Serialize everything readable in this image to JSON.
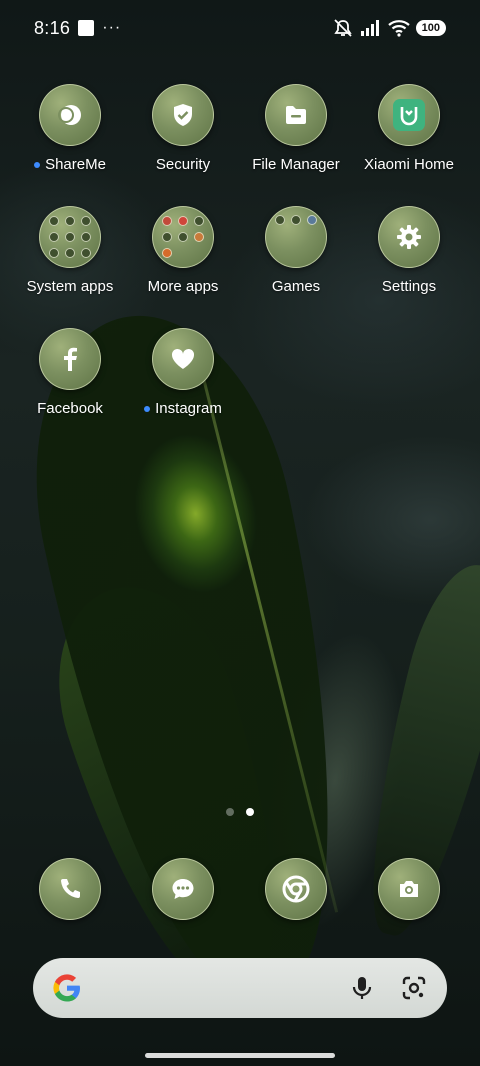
{
  "status_bar": {
    "time": "8:16",
    "overflow": "···",
    "battery": "100",
    "icons": [
      "mute-icon",
      "signal-icon",
      "wifi-icon"
    ]
  },
  "apps": [
    {
      "label": "ShareMe",
      "icon": "shareme-icon",
      "has_dot": true
    },
    {
      "label": "Security",
      "icon": "shield-icon",
      "has_dot": false
    },
    {
      "label": "File Manager",
      "icon": "folder-icon",
      "has_dot": false
    },
    {
      "label": "Xiaomi Home",
      "icon": "mi-home-icon",
      "has_dot": false
    },
    {
      "label": "System apps",
      "icon": "folder-system-apps",
      "has_dot": false
    },
    {
      "label": "More apps",
      "icon": "folder-more-apps",
      "has_dot": false
    },
    {
      "label": "Games",
      "icon": "folder-games",
      "has_dot": false
    },
    {
      "label": "Settings",
      "icon": "gear-icon",
      "has_dot": false
    },
    {
      "label": "Facebook",
      "icon": "facebook-icon",
      "has_dot": false
    },
    {
      "label": "Instagram",
      "icon": "heart-icon",
      "has_dot": true
    }
  ],
  "pager": {
    "pages": 2,
    "active": 2
  },
  "dock": [
    {
      "name": "phone",
      "icon": "phone-icon"
    },
    {
      "name": "messages",
      "icon": "message-icon"
    },
    {
      "name": "chrome",
      "icon": "chrome-icon"
    },
    {
      "name": "camera",
      "icon": "camera-icon"
    }
  ],
  "search": {
    "icons": [
      "google-icon",
      "mic-icon",
      "lens-icon"
    ]
  },
  "colors": {
    "accent_dot": "#3d8bff",
    "icon_fill": "#7c9060",
    "mi_home": "#3fb37f"
  }
}
